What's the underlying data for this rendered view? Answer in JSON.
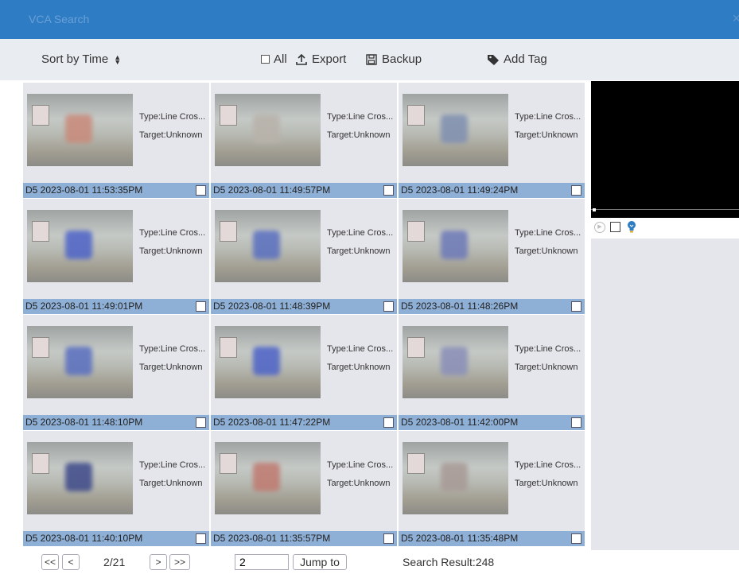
{
  "window": {
    "title": "VCA Search",
    "close_glyph": "×"
  },
  "toolbar": {
    "sort_label": "Sort by Time",
    "all_label": "All",
    "export_label": "Export",
    "backup_label": "Backup",
    "add_tag_label": "Add Tag"
  },
  "results": [
    {
      "caption": "D5 2023-08-01 11:53:35PM",
      "type": "Type:Line Cros...",
      "target": "Target:Unknown",
      "blob_color": "#c98a7a"
    },
    {
      "caption": "D5 2023-08-01 11:49:57PM",
      "type": "Type:Line Cros...",
      "target": "Target:Unknown",
      "blob_color": "#b8b2aa"
    },
    {
      "caption": "D5 2023-08-01 11:49:24PM",
      "type": "Type:Line Cros...",
      "target": "Target:Unknown",
      "blob_color": "#7f8fb0"
    },
    {
      "caption": "D5 2023-08-01 11:49:01PM",
      "type": "Type:Line Cros...",
      "target": "Target:Unknown",
      "blob_color": "#4d63c8"
    },
    {
      "caption": "D5 2023-08-01 11:48:39PM",
      "type": "Type:Line Cros...",
      "target": "Target:Unknown",
      "blob_color": "#5a6fc0"
    },
    {
      "caption": "D5 2023-08-01 11:48:26PM",
      "type": "Type:Line Cros...",
      "target": "Target:Unknown",
      "blob_color": "#6d79b8"
    },
    {
      "caption": "D5 2023-08-01 11:48:10PM",
      "type": "Type:Line Cros...",
      "target": "Target:Unknown",
      "blob_color": "#5a6fc0"
    },
    {
      "caption": "D5 2023-08-01 11:47:22PM",
      "type": "Type:Line Cros...",
      "target": "Target:Unknown",
      "blob_color": "#4d63c8"
    },
    {
      "caption": "D5 2023-08-01 11:42:00PM",
      "type": "Type:Line Cros...",
      "target": "Target:Unknown",
      "blob_color": "#8a8fb8"
    },
    {
      "caption": "D5 2023-08-01 11:40:10PM",
      "type": "Type:Line Cros...",
      "target": "Target:Unknown",
      "blob_color": "#3e4a8a"
    },
    {
      "caption": "D5 2023-08-01 11:35:57PM",
      "type": "Type:Line Cros...",
      "target": "Target:Unknown",
      "blob_color": "#c07a70"
    },
    {
      "caption": "D5 2023-08-01 11:35:48PM",
      "type": "Type:Line Cros...",
      "target": "Target:Unknown",
      "blob_color": "#a89a96"
    }
  ],
  "pagination": {
    "first_label": "<<",
    "prev_label": "<",
    "page_indicator": "2/21",
    "next_label": ">",
    "last_label": ">>",
    "jump_value": "2",
    "jump_label": "Jump to",
    "result_text": "Search Result:248"
  },
  "colors": {
    "titlebar": "#2e7cc4",
    "caption_bar": "#8fb0d6",
    "cell_bg": "#e5e6eb"
  }
}
